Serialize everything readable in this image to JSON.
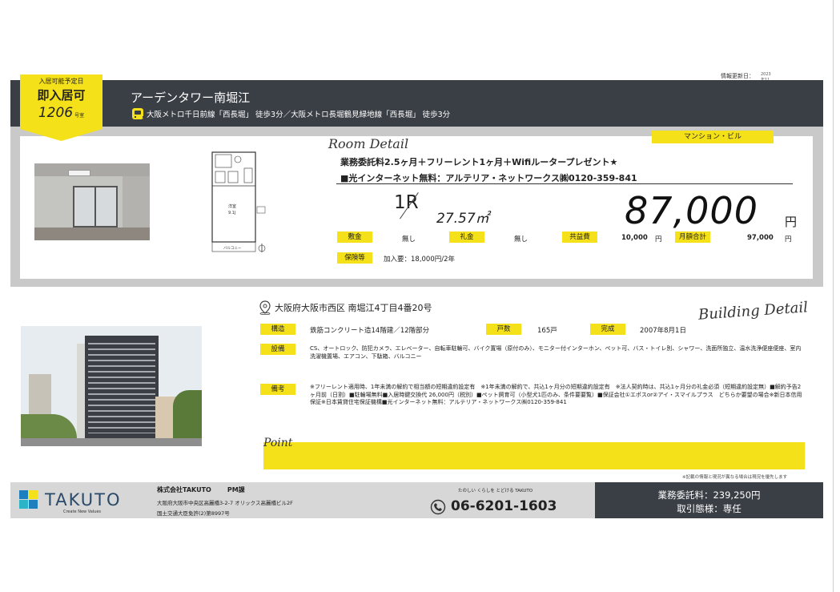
{
  "updated": {
    "label": "情報更新日：",
    "value": "2023年11月08日"
  },
  "badge": {
    "top_label": "入居可能予定日",
    "availability": "即入居可",
    "room_no": "1206",
    "room_unit": "号室"
  },
  "header": {
    "title": "アーデンタワー南堀江",
    "access": "大阪メトロ千日前線「西長堀」 徒歩3分／大阪メトロ長堀鶴見緑地線「西長堀」 徒歩3分"
  },
  "room": {
    "detail_label": "Room Detail",
    "property_type": "マンション・ビル",
    "promo": "業務委託料2.5ヶ月＋フリーレント1ヶ月＋Wifiルータープレゼント★",
    "internet": "■光インターネット無料：アルテリア・ネットワークス㈱0120-359-841",
    "layout": "1R",
    "area": "27.57㎡",
    "rent": "87,000",
    "rent_unit": "円",
    "floorplan": {
      "room_label": "洋室",
      "room_size": "9.1J",
      "balcony": "バルコニー"
    },
    "fees": {
      "shikikin_label": "敷金",
      "shikikin": "無し",
      "reikin_label": "礼金",
      "reikin": "無し",
      "kyoeki_label": "共益費",
      "kyoeki": "10,000",
      "kyoeki_unit": "円",
      "total_label": "月額合計",
      "total": "97,000",
      "total_unit": "円",
      "insurance_label": "保険等",
      "insurance": "加入要：18,000円/2年"
    }
  },
  "building": {
    "address": "大阪府大阪市西区 南堀江4丁目4番20号",
    "detail_label": "Building Detail",
    "structure_label": "構造",
    "structure": "鉄筋コンクリート造14階建／12階部分",
    "units_label": "戸数",
    "units": "165戸",
    "built_label": "完成",
    "built": "2007年8月1日",
    "equipment_label": "設備",
    "equipment": "CS、オートロック、防犯カメラ、エレベーター、自転車駐輪可、バイク置場（原付のみ）、モニター付インターホン、ペット可、バス・トイレ別、シャワー、洗面所独立、温水洗浄便座便座、室内洗濯機置場、エアコン、下駄箱、バルコニー",
    "remarks_label": "備考",
    "remarks": "※フリーレント適用時、1年未満の解約で相当額の短期違約設定有　※1年未満の解約で、共込1ヶ月分の短期違約設定有　※法人契約時は、共込1ヶ月分の礼金必須（短期違約設定無）■解約予告2ヶ月前（日割）■駐輪場無料■入居時鍵交換代 26,000円（税別）■ペット飼育可（小型犬1匹のみ、条件要要覧）■保証会社①エポスor②アイ・スマイルプラス　どちらか要望の場合※新日本信用保証※日本賃貸住宅保証機構■光インターネット無料：アルテリア・ネットワークス㈱0120-359-841"
  },
  "point": {
    "label": "Point"
  },
  "note": "※記載の情報と現況が異なる場合は現況を優先します",
  "footer": {
    "logo": "TAKUTO",
    "logo_sub": "Create New Values",
    "company": "株式会社TAKUTO",
    "dept": "PM課",
    "address": "大阪府大阪市中央区高麗橋3-2-7 オリックス高麗橋ビル2F",
    "license": "国土交通大臣免許(2)第8997号",
    "slogan": "たのしい くらしを とどける TAKUTO",
    "phone": "06-6201-1603",
    "fee": "業務委託料：239,250円",
    "deal": "取引態様：専任"
  },
  "colors": {
    "accent": "#f5e11a",
    "dark": "#3a3e45",
    "gray": "#c9c9c9",
    "footer_light": "#d7d7d7"
  }
}
